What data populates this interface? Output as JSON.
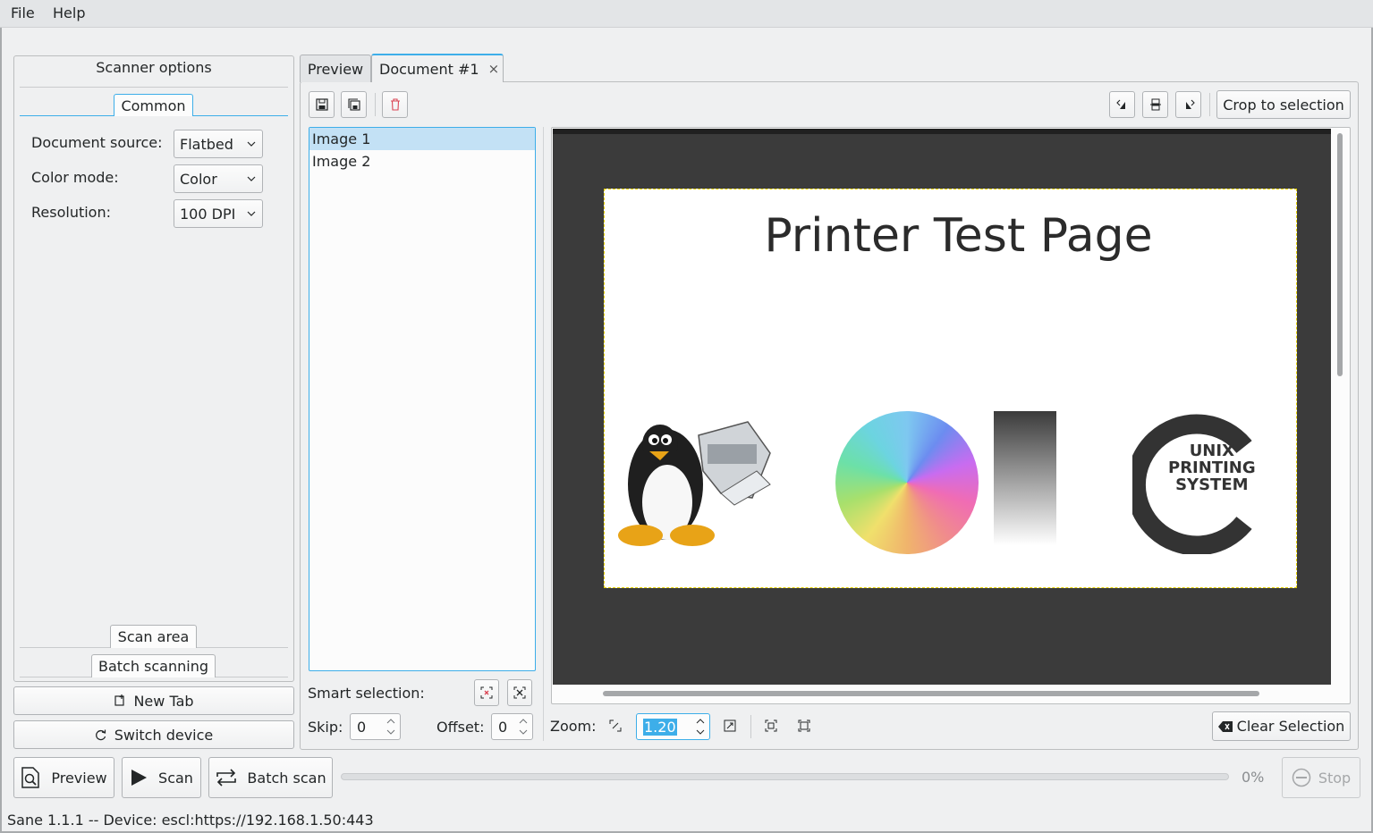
{
  "menu": {
    "file": "File",
    "help": "Help"
  },
  "left_panel": {
    "title": "Scanner options",
    "tab_common": "Common",
    "document_source": {
      "label": "Document source:",
      "value": "Flatbed"
    },
    "color_mode": {
      "label": "Color mode:",
      "value": "Color"
    },
    "resolution": {
      "label": "Resolution:",
      "value": "100 DPI"
    },
    "tab_scan_area": "Scan area",
    "tab_batch_scanning": "Batch scanning",
    "new_tab": "New Tab",
    "switch_device": "Switch device"
  },
  "tabs": {
    "preview": "Preview",
    "document": "Document #1",
    "close": "×"
  },
  "toolbar": {
    "crop_to_selection": "Crop to selection"
  },
  "image_list": {
    "items": [
      "Image 1",
      "Image 2"
    ]
  },
  "smart_selection": {
    "label": "Smart selection:"
  },
  "skip": {
    "label": "Skip:",
    "value": "0"
  },
  "offset": {
    "label": "Offset:",
    "value": "0"
  },
  "zoom": {
    "label": "Zoom:",
    "value": "1.20"
  },
  "clear_selection": "Clear Selection",
  "document_image": {
    "title": "Printer Test Page",
    "cups_text": [
      "UNIX",
      "PRINTING",
      "SYSTEM"
    ]
  },
  "bottom": {
    "preview": "Preview",
    "scan": "Scan",
    "batch_scan": "Batch scan",
    "progress_text": "0%",
    "progress": 0,
    "stop": "Stop"
  },
  "status": "Sane 1.1.1 -- Device: escl:https://192.168.1.50:443",
  "colors": {
    "accent": "#3daee9",
    "viewer_bg": "#3b3b3b",
    "selection_border": "#e6d200"
  }
}
